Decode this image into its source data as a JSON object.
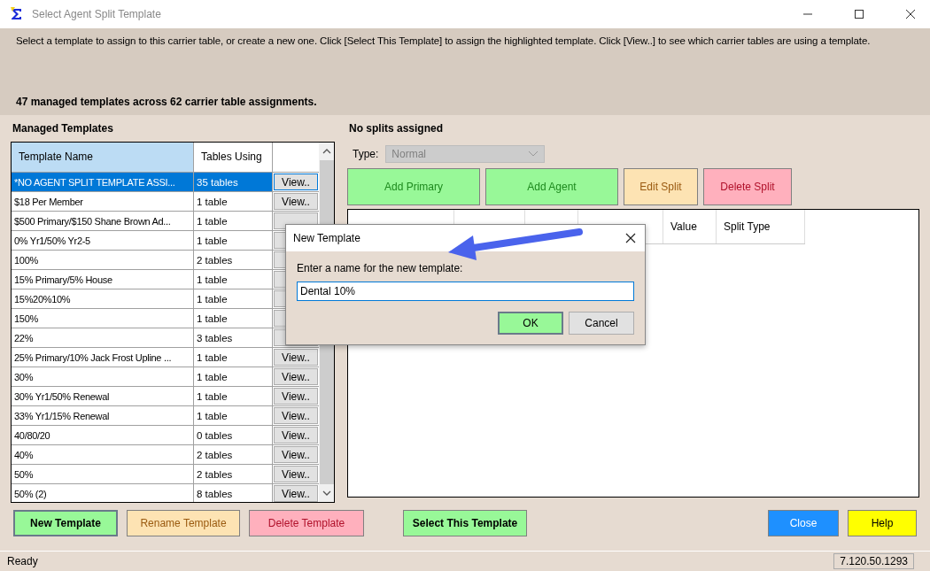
{
  "window": {
    "title": "Select Agent Split Template"
  },
  "instructions": "Select a template to assign to this carrier table, or create a new one. Click [Select This Template] to assign the highlighted template. Click [View..] to see which carrier tables are using a template.",
  "summary": "47 managed templates across 62 carrier table assignments.",
  "templates": {
    "heading": "Managed Templates",
    "columns": [
      "Template Name",
      "Tables Using"
    ],
    "rows": [
      {
        "name": "*NO AGENT SPLIT TEMPLATE ASSI...",
        "tables": "35 tables",
        "view": "View..",
        "selected": true
      },
      {
        "name": "$18 Per Member",
        "tables": "1 table",
        "view": "View..",
        "selected": false
      },
      {
        "name": "$500 Primary/$150 Shane Brown Ad...",
        "tables": "1 table",
        "selected": false
      },
      {
        "name": "0% Yr1/50% Yr2-5",
        "tables": "1 table",
        "selected": false
      },
      {
        "name": "100%",
        "tables": "2 tables",
        "selected": false
      },
      {
        "name": "15% Primary/5% House",
        "tables": "1 table",
        "selected": false
      },
      {
        "name": "15%20%10%",
        "tables": "1 table",
        "selected": false
      },
      {
        "name": "150%",
        "tables": "1 table",
        "selected": false
      },
      {
        "name": "22%",
        "tables": "3 tables",
        "selected": false
      },
      {
        "name": "25% Primary/10% Jack Frost Upline ...",
        "tables": "1 table",
        "view": "View..",
        "selected": false
      },
      {
        "name": "30%",
        "tables": "1 table",
        "view": "View..",
        "selected": false
      },
      {
        "name": "30% Yr1/50% Renewal",
        "tables": "1 table",
        "view": "View..",
        "selected": false
      },
      {
        "name": "33% Yr1/15% Renewal",
        "tables": "1 table",
        "view": "View..",
        "selected": false
      },
      {
        "name": "40/80/20",
        "tables": "0 tables",
        "view": "View..",
        "selected": false
      },
      {
        "name": "40%",
        "tables": "2 tables",
        "view": "View..",
        "selected": false
      },
      {
        "name": "50%",
        "tables": "2 tables",
        "view": "View..",
        "selected": false
      },
      {
        "name": "50% (2)",
        "tables": "8 tables",
        "view": "View..",
        "selected": false
      }
    ]
  },
  "splits": {
    "heading": "No splits assigned",
    "type_label": "Type:",
    "type_value": "Normal",
    "type_disabled": true,
    "buttons": [
      {
        "label": "Add Primary",
        "kind": "positive"
      },
      {
        "label": "Add Agent",
        "kind": "positive"
      },
      {
        "label": "Edit Split",
        "kind": "warning"
      },
      {
        "label": "Delete Split",
        "kind": "danger"
      }
    ],
    "columns": [
      "Value",
      "Split Type"
    ]
  },
  "actions": [
    {
      "label": "New Template",
      "kind": "positive",
      "bold": true
    },
    {
      "label": "Rename Template",
      "kind": "warning",
      "bold": false
    },
    {
      "label": "Delete Template",
      "kind": "danger",
      "bold": false
    },
    {
      "label": "Select This Template",
      "kind": "positive",
      "bold": true
    },
    {
      "label": "Close",
      "kind": "primary",
      "bold": false
    },
    {
      "label": "Help",
      "kind": "help",
      "bold": false
    }
  ],
  "status_bar": {
    "text": "Ready",
    "version": "7.120.50.1293"
  },
  "dialog": {
    "title": "New Template",
    "prompt": "Enter a name for the new template:",
    "value": "Dental 10%",
    "ok": "OK",
    "cancel": "Cancel"
  }
}
